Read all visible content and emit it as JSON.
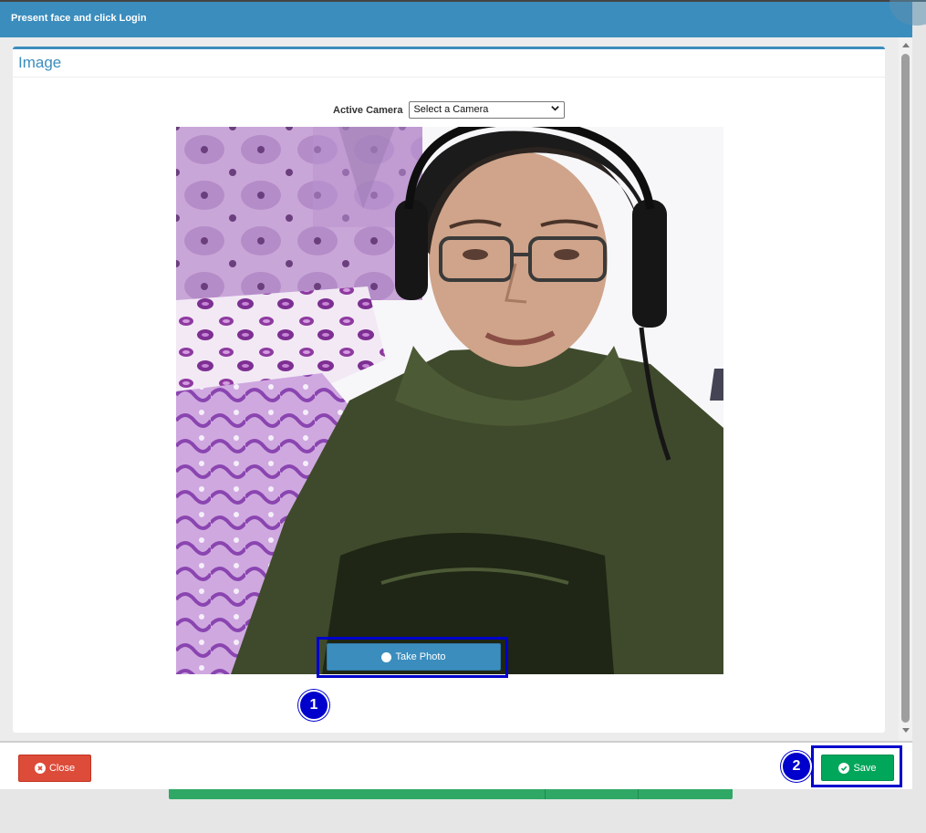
{
  "header": {
    "title": "Present face and click Login"
  },
  "panel": {
    "title": "Image"
  },
  "camera": {
    "label": "Active Camera",
    "selected": "Select a Camera"
  },
  "buttons": {
    "take_photo": "Take Photo",
    "close": "Close",
    "save": "Save"
  },
  "annotations": {
    "badge_1": "1",
    "badge_2": "2"
  },
  "colors": {
    "primary": "#3b8dbd",
    "danger": "#dd4b39",
    "success": "#00a65a",
    "annotation": "#0000cc"
  }
}
